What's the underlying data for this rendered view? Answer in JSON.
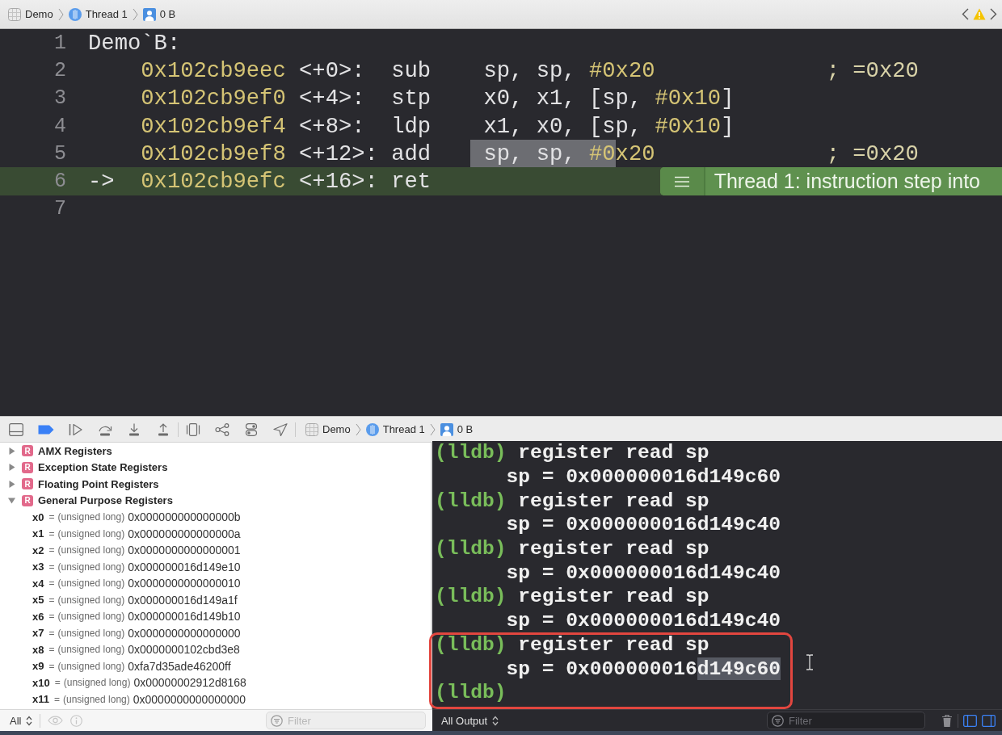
{
  "jump_bar": {
    "breadcrumb": [
      {
        "kind": "project",
        "label": "Demo"
      },
      {
        "kind": "thread",
        "label": "Thread 1"
      },
      {
        "kind": "frame",
        "label": "0 B"
      }
    ]
  },
  "editor": {
    "lines": [
      {
        "number": "1",
        "kind": "label",
        "current": false,
        "text": "Demo`B:"
      },
      {
        "number": "2",
        "kind": "instruction",
        "current": false,
        "address": "0x102cb9eec",
        "offset": "<+0>:",
        "mnemonic": "sub",
        "operands": [
          {
            "text": "sp, sp, ",
            "kind": "plain",
            "selected": false
          },
          {
            "text": "#0x20",
            "kind": "number",
            "selected": false
          }
        ],
        "comment": "; =0x20"
      },
      {
        "number": "3",
        "kind": "instruction",
        "current": false,
        "address": "0x102cb9ef0",
        "offset": "<+4>:",
        "mnemonic": "stp",
        "operands": [
          {
            "text": "x0, x1, [sp, ",
            "kind": "plain",
            "selected": false
          },
          {
            "text": "#0x10",
            "kind": "number",
            "selected": false
          },
          {
            "text": "]",
            "kind": "plain",
            "selected": false
          }
        ]
      },
      {
        "number": "4",
        "kind": "instruction",
        "current": false,
        "address": "0x102cb9ef4",
        "offset": "<+8>:",
        "mnemonic": "ldp",
        "operands": [
          {
            "text": "x1, x0, [sp, ",
            "kind": "plain",
            "selected": false
          },
          {
            "text": "#0x10",
            "kind": "number",
            "selected": false
          },
          {
            "text": "]",
            "kind": "plain",
            "selected": false
          }
        ]
      },
      {
        "number": "5",
        "kind": "instruction",
        "current": false,
        "address": "0x102cb9ef8",
        "offset": "<+12>:",
        "mnemonic": "add",
        "operands": [
          {
            "text": "sp, sp, ",
            "kind": "plain",
            "selected": true
          },
          {
            "text": "#0",
            "kind": "number",
            "selected": true
          },
          {
            "text": "x20",
            "kind": "number",
            "selected": false
          }
        ],
        "comment": "; =0x20"
      },
      {
        "number": "6",
        "kind": "instruction",
        "current": true,
        "marker": "->",
        "address": "0x102cb9efc",
        "offset": "<+16>:",
        "mnemonic": "ret",
        "annotation": "Thread 1: instruction step into"
      },
      {
        "number": "7",
        "kind": "empty",
        "current": false
      }
    ]
  },
  "debug_bar": {
    "breakpoints_active": true,
    "breadcrumb": [
      {
        "kind": "project",
        "label": "Demo"
      },
      {
        "kind": "thread",
        "label": "Thread 1"
      },
      {
        "kind": "frame",
        "label": "0 B"
      }
    ]
  },
  "variables": {
    "groups": [
      {
        "badge": "R",
        "name": "AMX Registers",
        "expanded": false
      },
      {
        "badge": "R",
        "name": "Exception State Registers",
        "expanded": false
      },
      {
        "badge": "R",
        "name": "Floating Point Registers",
        "expanded": false
      },
      {
        "badge": "R",
        "name": "General Purpose Registers",
        "expanded": true,
        "children": [
          {
            "name": "x0",
            "separator": "=",
            "type": "(unsigned long)",
            "value": "0x000000000000000b"
          },
          {
            "name": "x1",
            "separator": "=",
            "type": "(unsigned long)",
            "value": "0x000000000000000a"
          },
          {
            "name": "x2",
            "separator": "=",
            "type": "(unsigned long)",
            "value": "0x0000000000000001"
          },
          {
            "name": "x3",
            "separator": "=",
            "type": "(unsigned long)",
            "value": "0x000000016d149e10"
          },
          {
            "name": "x4",
            "separator": "=",
            "type": "(unsigned long)",
            "value": "0x0000000000000010"
          },
          {
            "name": "x5",
            "separator": "=",
            "type": "(unsigned long)",
            "value": "0x000000016d149a1f"
          },
          {
            "name": "x6",
            "separator": "=",
            "type": "(unsigned long)",
            "value": "0x000000016d149b10"
          },
          {
            "name": "x7",
            "separator": "=",
            "type": "(unsigned long)",
            "value": "0x0000000000000000"
          },
          {
            "name": "x8",
            "separator": "=",
            "type": "(unsigned long)",
            "value": "0x0000000102cbd3e8"
          },
          {
            "name": "x9",
            "separator": "=",
            "type": "(unsigned long)",
            "value": "0xfa7d35ade46200ff"
          },
          {
            "name": "x10",
            "separator": "=",
            "type": "(unsigned long)",
            "value": "0x00000002912d8168"
          },
          {
            "name": "x11",
            "separator": "=",
            "type": "(unsigned long)",
            "value": "0x0000000000000000"
          }
        ]
      }
    ],
    "footer": {
      "scope": "All",
      "actions_disabled": true,
      "filter_placeholder": "Filter"
    }
  },
  "console": {
    "entries": [
      {
        "prompt": "(lldb)",
        "command": "register read sp",
        "output": [
          {
            "text": "sp = 0x000000016d149c60",
            "selected": false
          }
        ],
        "framed": false
      },
      {
        "prompt": "(lldb)",
        "command": "register read sp",
        "output": [
          {
            "text": "sp = 0x000000016d149c40",
            "selected": false
          }
        ],
        "framed": false
      },
      {
        "prompt": "(lldb)",
        "command": "register read sp",
        "output": [
          {
            "text": "sp = 0x000000016d149c40",
            "selected": false
          }
        ],
        "framed": false
      },
      {
        "prompt": "(lldb)",
        "command": "register read sp",
        "output": [
          {
            "text": "sp = 0x000000016d149c40",
            "selected": false
          }
        ],
        "framed": false
      },
      {
        "prompt": "(lldb)",
        "command": "register read sp",
        "output": [
          {
            "text": "sp = 0x000000016",
            "selected": false
          },
          {
            "text": "d149c60",
            "selected": true
          }
        ],
        "framed": true
      },
      {
        "prompt": "(lldb)",
        "framed": true
      }
    ],
    "footer": {
      "scope": "All Output",
      "filter_placeholder": "Filter",
      "variables_pane_shown": true,
      "console_pane_shown": true
    }
  }
}
